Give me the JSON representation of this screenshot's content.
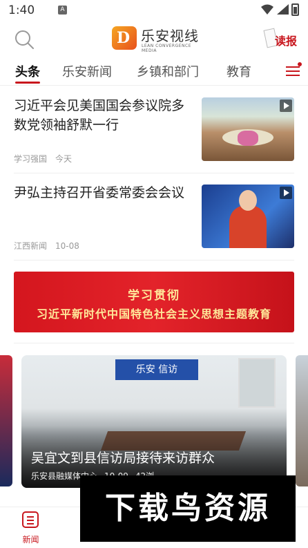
{
  "status_bar": {
    "time": "1:40",
    "notif_glyph": "A"
  },
  "header": {
    "logo_mark": "D",
    "app_name": "乐安视线",
    "app_subtitle": "LEAN CONVERGENCE MEDIA",
    "read_label": "读报"
  },
  "tabs": [
    {
      "label": "头条",
      "active": true
    },
    {
      "label": "乐安新闻",
      "active": false
    },
    {
      "label": "乡镇和部门",
      "active": false
    },
    {
      "label": "教育",
      "active": false
    }
  ],
  "news": [
    {
      "title": "习近平会见美国国会参议院多数党领袖舒默一行",
      "source": "学习强国",
      "time": "今天",
      "has_video": true
    },
    {
      "title": "尹弘主持召开省委常委会会议",
      "source": "江西新闻",
      "time": "10-08",
      "has_video": true
    }
  ],
  "banner": {
    "line1": "学习贯彻",
    "line2": "习近平新时代中国特色社会主义思想主题教育"
  },
  "carousel": {
    "sign_text": "乐安 信访",
    "caption": "吴宜文到县信访局接待来访群众",
    "source": "乐安县融媒体中心",
    "date": "10-09",
    "views": "42浏"
  },
  "watermark": "下载鸟资源",
  "bottom_nav": [
    {
      "label": "新闻",
      "active": true
    },
    {
      "label": "",
      "active": false
    },
    {
      "label": "",
      "active": false
    },
    {
      "label": "",
      "active": false
    },
    {
      "label": "",
      "active": false
    }
  ],
  "colors": {
    "accent": "#c8161d"
  }
}
